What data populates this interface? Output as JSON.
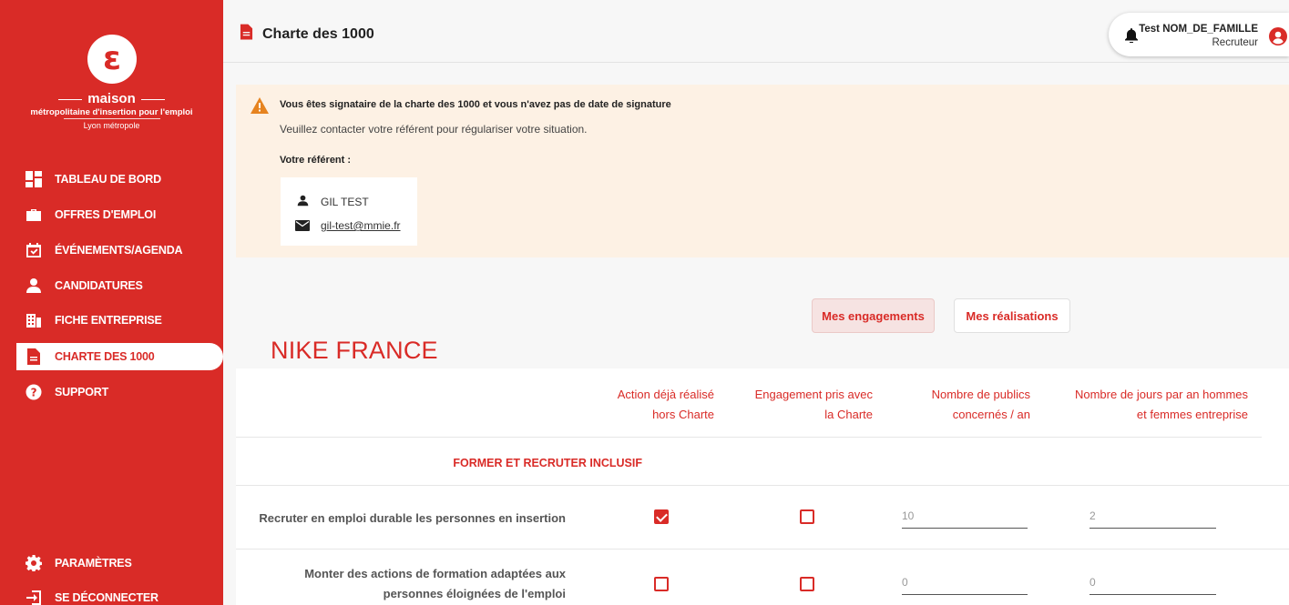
{
  "brand": {
    "logo_letter": "ε",
    "line1": "maison",
    "line2": "métropolitaine d'insertion pour l'emploi",
    "line3": "Lyon métropole"
  },
  "nav": {
    "items": [
      {
        "label": "TABLEAU DE BORD",
        "icon": "dashboard-icon"
      },
      {
        "label": "OFFRES D'EMPLOI",
        "icon": "briefcase-icon"
      },
      {
        "label": "ÉVÉNEMENTS/AGENDA",
        "icon": "calendar-check-icon"
      },
      {
        "label": "CANDIDATURES",
        "icon": "user-icon"
      },
      {
        "label": "FICHE ENTREPRISE",
        "icon": "building-icon"
      },
      {
        "label": "CHARTE DES 1000",
        "icon": "file-icon"
      },
      {
        "label": "SUPPORT",
        "icon": "question-circle-icon"
      }
    ],
    "bottom": [
      {
        "label": "PARAMÈTRES",
        "icon": "gear-icon"
      },
      {
        "label": "SE DÉCONNECTER",
        "icon": "logout-icon"
      }
    ]
  },
  "header": {
    "title": "Charte des 1000",
    "user_name": "Test NOM_DE_FAMILLE",
    "user_role": "Recruteur"
  },
  "alert": {
    "title": "Vous êtes signataire de la charte des 1000 et vous n'avez pas de date de signature",
    "text": "Veuillez contacter votre référent pour régulariser votre situation.",
    "ref_label": "Votre référent :",
    "ref_name": "GIL TEST",
    "ref_email": "gil-test@mmie.fr"
  },
  "tabs": {
    "engagements": "Mes engagements",
    "realisations": "Mes réalisations"
  },
  "company": "NIKE FRANCE",
  "table": {
    "columns": [
      {
        "line1": "Action déjà réalisé",
        "line2": "hors Charte"
      },
      {
        "line1": "Engagement pris avec",
        "line2": "la Charte"
      },
      {
        "line1": "Nombre de publics",
        "line2": "concernés / an"
      },
      {
        "line1": "Nombre de jours par an hommes",
        "line2": "et femmes entreprise"
      }
    ],
    "section": "FORMER ET RECRUTER INCLUSIF",
    "rows": [
      {
        "label_line1": "Recruter en emploi durable les personnes en insertion",
        "label_line2": "",
        "realise": true,
        "engagement": false,
        "publics": "10",
        "jours": "2"
      },
      {
        "label_line1": "Monter des actions de formation adaptées aux",
        "label_line2": "personnes éloignées de l'emploi",
        "realise": false,
        "engagement": false,
        "publics": "0",
        "jours": "0"
      }
    ]
  },
  "colors": {
    "primary": "#d92b27",
    "alert_bg": "#fdf1e4",
    "warning": "#e6831f"
  }
}
